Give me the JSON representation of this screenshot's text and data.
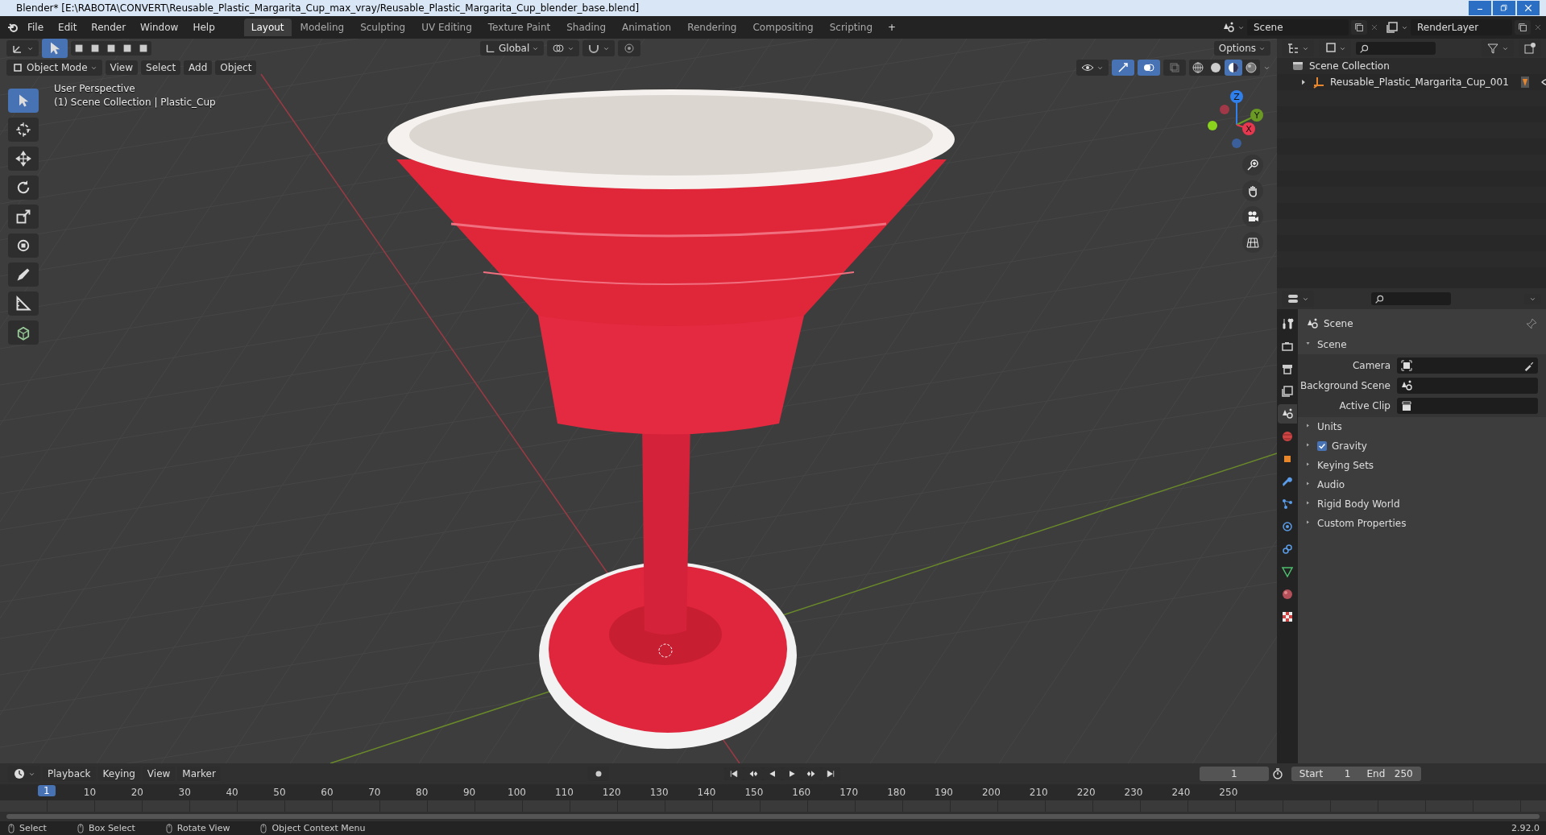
{
  "window": {
    "title": "Blender* [E:\\RABOTA\\CONVERT\\Reusable_Plastic_Margarita_Cup_max_vray/Reusable_Plastic_Margarita_Cup_blender_base.blend]"
  },
  "menu": [
    "File",
    "Edit",
    "Render",
    "Window",
    "Help"
  ],
  "workspaces": [
    {
      "label": "Layout",
      "selected": true
    },
    {
      "label": "Modeling",
      "selected": false
    },
    {
      "label": "Sculpting",
      "selected": false
    },
    {
      "label": "UV Editing",
      "selected": false
    },
    {
      "label": "Texture Paint",
      "selected": false
    },
    {
      "label": "Shading",
      "selected": false
    },
    {
      "label": "Animation",
      "selected": false
    },
    {
      "label": "Rendering",
      "selected": false
    },
    {
      "label": "Compositing",
      "selected": false
    },
    {
      "label": "Scripting",
      "selected": false
    }
  ],
  "add_workspace": "+",
  "scene_field": {
    "value": "Scene"
  },
  "view_layer_field": {
    "value": "RenderLayer"
  },
  "viewport": {
    "orientation": "Global",
    "options": "Options",
    "mode": "Object Mode",
    "menus": [
      "View",
      "Select",
      "Add",
      "Object"
    ],
    "shading_modes": [
      {
        "kind": "wireframe",
        "selected": false
      },
      {
        "kind": "solid",
        "selected": false
      },
      {
        "kind": "material",
        "selected": true
      },
      {
        "kind": "rendered",
        "selected": false
      }
    ],
    "overlay_text": [
      "User Perspective",
      "(1) Scene Collection | Plastic_Cup"
    ],
    "tools": [
      {
        "kind": "select",
        "selected": true
      },
      {
        "kind": "cursor",
        "selected": false
      },
      {
        "kind": "move",
        "selected": false
      },
      {
        "kind": "rotate",
        "selected": false
      },
      {
        "kind": "scale",
        "selected": false
      },
      {
        "kind": "transform",
        "selected": false
      },
      {
        "kind": "annotate",
        "selected": false
      },
      {
        "kind": "measure",
        "selected": false
      },
      {
        "kind": "add-cube",
        "selected": false
      }
    ],
    "gizmo_axes": [
      {
        "label": "Z",
        "color": "#2f80ed"
      },
      {
        "label": "Y",
        "color": "#6a9a23"
      },
      {
        "label": "X",
        "color": "#e8384f"
      }
    ]
  },
  "outliner": {
    "root": "Scene Collection",
    "items": [
      {
        "label": "Reusable_Plastic_Margarita_Cup_001",
        "expanded": false
      }
    ]
  },
  "properties": {
    "tabs": [
      {
        "kind": "tool",
        "selected": false
      },
      {
        "kind": "render",
        "selected": false
      },
      {
        "kind": "output",
        "selected": false
      },
      {
        "kind": "view-layer",
        "selected": false
      },
      {
        "kind": "scene",
        "selected": true
      },
      {
        "kind": "world",
        "selected": false
      },
      {
        "kind": "object",
        "selected": false
      },
      {
        "kind": "modifier",
        "selected": false
      },
      {
        "kind": "particles",
        "selected": false
      },
      {
        "kind": "physics",
        "selected": false
      },
      {
        "kind": "constraint",
        "selected": false
      },
      {
        "kind": "data",
        "selected": false
      },
      {
        "kind": "material",
        "selected": false
      },
      {
        "kind": "texture",
        "selected": false
      }
    ],
    "context": "Scene",
    "panel": {
      "title": "Scene",
      "expanded": true,
      "fields": [
        {
          "label": "Camera",
          "kind": "camera"
        },
        {
          "label": "Background Scene",
          "kind": "scene"
        },
        {
          "label": "Active Clip",
          "kind": "clip"
        }
      ]
    },
    "sections": [
      {
        "label": "Units",
        "kind": "plain"
      },
      {
        "label": "Gravity",
        "kind": "checkbox",
        "checked": true
      },
      {
        "label": "Keying Sets",
        "kind": "plain"
      },
      {
        "label": "Audio",
        "kind": "plain"
      },
      {
        "label": "Rigid Body World",
        "kind": "plain"
      },
      {
        "label": "Custom Properties",
        "kind": "plain"
      }
    ]
  },
  "timeline": {
    "menus": [
      "Playback",
      "Keying",
      "View",
      "Marker"
    ],
    "current_frame": "1",
    "start_label": "Start",
    "start": "1",
    "end_label": "End",
    "end": "250",
    "playhead": "1",
    "ruler": [
      "10",
      "20",
      "30",
      "40",
      "50",
      "60",
      "70",
      "80",
      "90",
      "100",
      "110",
      "120",
      "130",
      "140",
      "150",
      "160",
      "170",
      "180",
      "190",
      "200",
      "210",
      "220",
      "230",
      "240",
      "250"
    ]
  },
  "status_bar": {
    "hints": [
      "Select",
      "Box Select",
      "Rotate View",
      "Object Context Menu"
    ],
    "version": "2.92.0"
  }
}
